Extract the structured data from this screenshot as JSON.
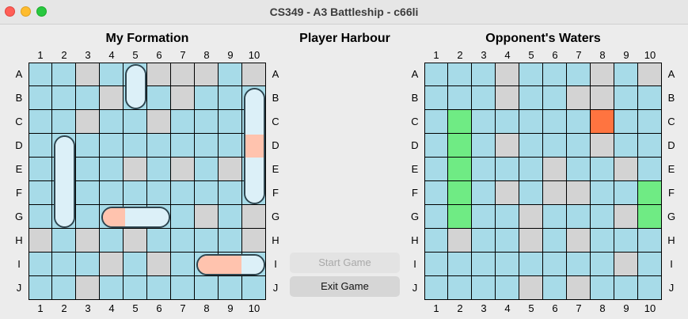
{
  "window": {
    "title": "CS349 - A3 Battleship - c66li"
  },
  "colors": {
    "water": "#a7dbe8",
    "miss": "#d3d3d3",
    "hit_enemy": "#ff7440",
    "sunk_enemy": "#6feb84",
    "ship_body": "#dcf0f8",
    "ship_hit": "#ffc3ae",
    "ship_outline": "#2f4650"
  },
  "left_board": {
    "title": "My Formation",
    "cols": [
      "1",
      "2",
      "3",
      "4",
      "5",
      "6",
      "7",
      "8",
      "9",
      "10"
    ],
    "rows": [
      "A",
      "B",
      "C",
      "D",
      "E",
      "F",
      "G",
      "H",
      "I",
      "J"
    ],
    "grid": [
      "WWMWWMMMWM",
      "WWWMWWMWWW",
      "WWMWWMWWWW",
      "WWWWWWWWWW",
      "WWWWMWMWMW",
      "WWWWWWWWWW",
      "WWWWWWWMWM",
      "MWMWMWWWWM",
      "WWWMWMWWWW",
      "WWMWWWWWWW"
    ],
    "ships": [
      {
        "row": 0,
        "col": 4,
        "len": 2,
        "dir": "v",
        "hits": []
      },
      {
        "row": 1,
        "col": 9,
        "len": 5,
        "dir": "v",
        "hits": [
          2
        ]
      },
      {
        "row": 3,
        "col": 1,
        "len": 4,
        "dir": "v",
        "hits": []
      },
      {
        "row": 6,
        "col": 3,
        "len": 3,
        "dir": "h",
        "hits": [
          0
        ]
      },
      {
        "row": 8,
        "col": 7,
        "len": 3,
        "dir": "h",
        "hits": [
          0,
          1
        ]
      }
    ]
  },
  "middle": {
    "title": "Player Harbour",
    "start_label": "Start Game",
    "exit_label": "Exit Game"
  },
  "right_board": {
    "title": "Opponent's Waters",
    "cols": [
      "1",
      "2",
      "3",
      "4",
      "5",
      "6",
      "7",
      "8",
      "9",
      "10"
    ],
    "rows": [
      "A",
      "B",
      "C",
      "D",
      "E",
      "F",
      "G",
      "H",
      "I",
      "J"
    ],
    "grid": [
      "WWWMWWWMWM",
      "WWWMWWMMWW",
      "WSWWWWWHWW",
      "WSWMWWWMWW",
      "WSWWWMWWMW",
      "WSWMWMMWWS",
      "WSWWMWWWMS",
      "WMWWMWMWWW",
      "WWWWWWWWMW",
      "WWWWMWMWWW"
    ]
  }
}
